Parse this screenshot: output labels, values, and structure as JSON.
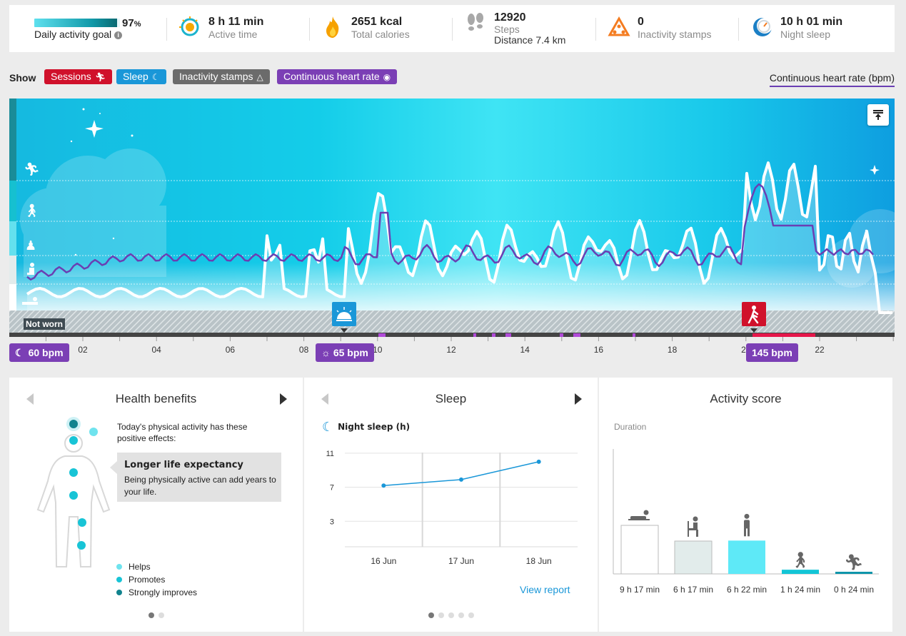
{
  "stats": {
    "goal": {
      "percent": 97,
      "percent_text": "97",
      "percent_unit": "%",
      "label": "Daily activity goal",
      "info_icon": "info-icon"
    },
    "active_time": {
      "value": "8 h 11 min",
      "label": "Active time",
      "icon": "sun-icon"
    },
    "calories": {
      "value": "2651 kcal",
      "label": "Total calories",
      "icon": "flame-icon"
    },
    "steps": {
      "value": "12920",
      "label": "Steps",
      "distance": "Distance 7.4 km",
      "icon": "footsteps-icon"
    },
    "inactivity": {
      "value": "0",
      "label": "Inactivity stamps",
      "icon": "triangle-icon"
    },
    "sleep": {
      "value": "10 h 01 min",
      "label": "Night sleep",
      "icon": "moon-clock-icon"
    }
  },
  "filters": {
    "show_label": "Show",
    "chips": [
      {
        "label": "Sessions",
        "color": "#d0112b",
        "icon": "runner-icon"
      },
      {
        "label": "Sleep",
        "color": "#1a97d8",
        "icon": "moon-icon"
      },
      {
        "label": "Inactivity stamps",
        "color": "#6b6b6b",
        "icon": "triangle-icon"
      },
      {
        "label": "Continuous heart rate",
        "color": "#7b3fb5",
        "icon": "heart-rate-icon"
      }
    ],
    "legend_right": "Continuous heart rate (bpm)"
  },
  "activity_chart": {
    "time_labels": [
      "02",
      "04",
      "06",
      "08",
      "10",
      "12",
      "14",
      "16",
      "18",
      "20",
      "22"
    ],
    "not_worn_label": "Not worn",
    "badges": [
      {
        "text": "60 bpm",
        "icon": "moon-icon"
      },
      {
        "text": "65 bpm",
        "icon": "sun-icon"
      },
      {
        "text": "145 bpm",
        "icon": ""
      }
    ],
    "hr_color": "#6a3fb3",
    "activity_color": "#ffffff",
    "wake_marker_icon": "sunrise-icon",
    "session_marker_icon": "walker-icon",
    "level_icons": [
      "running-icon",
      "walking-icon",
      "standing-icon",
      "sitting-icon",
      "lying-icon"
    ]
  },
  "health": {
    "title": "Health benefits",
    "intro": "Today's physical activity has these positive effects:",
    "card_title": "Longer life expectancy",
    "card_text": "Being physically active can add years to your life.",
    "legend": [
      {
        "label": "Helps",
        "color": "#6fe3ee"
      },
      {
        "label": "Promotes",
        "color": "#18c4d6"
      },
      {
        "label": "Strongly improves",
        "color": "#11838e"
      }
    ]
  },
  "sleep_panel": {
    "title": "Sleep",
    "subtitle": "Night sleep (h)",
    "link": "View report",
    "chart_data": {
      "type": "line",
      "categories": [
        "16 Jun",
        "17 Jun",
        "18 Jun"
      ],
      "values": [
        7.2,
        7.9,
        10
      ],
      "yticks": [
        "11",
        "7",
        "3"
      ],
      "ylim": [
        0,
        12
      ]
    }
  },
  "activity_score": {
    "title": "Activity score",
    "subtitle": "Duration",
    "chart_data": {
      "type": "bar",
      "categories": [
        "9 h 17 min",
        "6 h 17 min",
        "6 h 22 min",
        "1 h 24 min",
        "0 h 24 min"
      ],
      "values": [
        9.28,
        6.28,
        6.37,
        0.8,
        0.2
      ],
      "colors": [
        "#ffffff",
        "#e2eceb",
        "#5ee9f7",
        "#12c5d6",
        "#0f95aa"
      ],
      "icons": [
        "lying-icon",
        "sitting-icon",
        "standing-icon",
        "walking-icon",
        "running-icon"
      ]
    }
  }
}
